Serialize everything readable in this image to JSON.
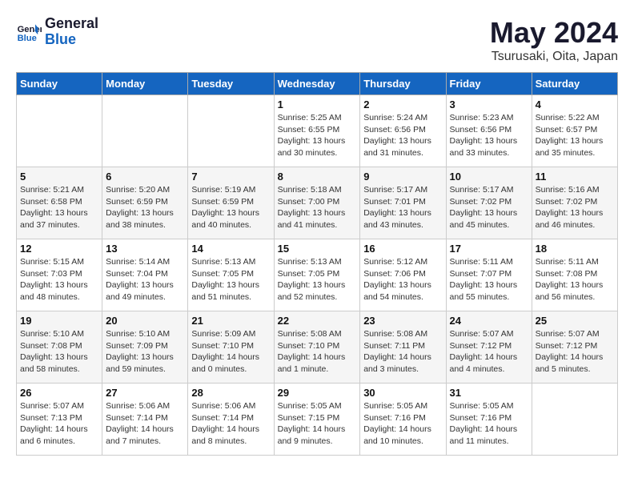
{
  "logo": {
    "line1": "General",
    "line2": "Blue"
  },
  "title": "May 2024",
  "subtitle": "Tsurusaki, Oita, Japan",
  "days_of_week": [
    "Sunday",
    "Monday",
    "Tuesday",
    "Wednesday",
    "Thursday",
    "Friday",
    "Saturday"
  ],
  "weeks": [
    [
      {
        "day": "",
        "info": ""
      },
      {
        "day": "",
        "info": ""
      },
      {
        "day": "",
        "info": ""
      },
      {
        "day": "1",
        "info": "Sunrise: 5:25 AM\nSunset: 6:55 PM\nDaylight: 13 hours\nand 30 minutes."
      },
      {
        "day": "2",
        "info": "Sunrise: 5:24 AM\nSunset: 6:56 PM\nDaylight: 13 hours\nand 31 minutes."
      },
      {
        "day": "3",
        "info": "Sunrise: 5:23 AM\nSunset: 6:56 PM\nDaylight: 13 hours\nand 33 minutes."
      },
      {
        "day": "4",
        "info": "Sunrise: 5:22 AM\nSunset: 6:57 PM\nDaylight: 13 hours\nand 35 minutes."
      }
    ],
    [
      {
        "day": "5",
        "info": "Sunrise: 5:21 AM\nSunset: 6:58 PM\nDaylight: 13 hours\nand 37 minutes."
      },
      {
        "day": "6",
        "info": "Sunrise: 5:20 AM\nSunset: 6:59 PM\nDaylight: 13 hours\nand 38 minutes."
      },
      {
        "day": "7",
        "info": "Sunrise: 5:19 AM\nSunset: 6:59 PM\nDaylight: 13 hours\nand 40 minutes."
      },
      {
        "day": "8",
        "info": "Sunrise: 5:18 AM\nSunset: 7:00 PM\nDaylight: 13 hours\nand 41 minutes."
      },
      {
        "day": "9",
        "info": "Sunrise: 5:17 AM\nSunset: 7:01 PM\nDaylight: 13 hours\nand 43 minutes."
      },
      {
        "day": "10",
        "info": "Sunrise: 5:17 AM\nSunset: 7:02 PM\nDaylight: 13 hours\nand 45 minutes."
      },
      {
        "day": "11",
        "info": "Sunrise: 5:16 AM\nSunset: 7:02 PM\nDaylight: 13 hours\nand 46 minutes."
      }
    ],
    [
      {
        "day": "12",
        "info": "Sunrise: 5:15 AM\nSunset: 7:03 PM\nDaylight: 13 hours\nand 48 minutes."
      },
      {
        "day": "13",
        "info": "Sunrise: 5:14 AM\nSunset: 7:04 PM\nDaylight: 13 hours\nand 49 minutes."
      },
      {
        "day": "14",
        "info": "Sunrise: 5:13 AM\nSunset: 7:05 PM\nDaylight: 13 hours\nand 51 minutes."
      },
      {
        "day": "15",
        "info": "Sunrise: 5:13 AM\nSunset: 7:05 PM\nDaylight: 13 hours\nand 52 minutes."
      },
      {
        "day": "16",
        "info": "Sunrise: 5:12 AM\nSunset: 7:06 PM\nDaylight: 13 hours\nand 54 minutes."
      },
      {
        "day": "17",
        "info": "Sunrise: 5:11 AM\nSunset: 7:07 PM\nDaylight: 13 hours\nand 55 minutes."
      },
      {
        "day": "18",
        "info": "Sunrise: 5:11 AM\nSunset: 7:08 PM\nDaylight: 13 hours\nand 56 minutes."
      }
    ],
    [
      {
        "day": "19",
        "info": "Sunrise: 5:10 AM\nSunset: 7:08 PM\nDaylight: 13 hours\nand 58 minutes."
      },
      {
        "day": "20",
        "info": "Sunrise: 5:10 AM\nSunset: 7:09 PM\nDaylight: 13 hours\nand 59 minutes."
      },
      {
        "day": "21",
        "info": "Sunrise: 5:09 AM\nSunset: 7:10 PM\nDaylight: 14 hours\nand 0 minutes."
      },
      {
        "day": "22",
        "info": "Sunrise: 5:08 AM\nSunset: 7:10 PM\nDaylight: 14 hours\nand 1 minute."
      },
      {
        "day": "23",
        "info": "Sunrise: 5:08 AM\nSunset: 7:11 PM\nDaylight: 14 hours\nand 3 minutes."
      },
      {
        "day": "24",
        "info": "Sunrise: 5:07 AM\nSunset: 7:12 PM\nDaylight: 14 hours\nand 4 minutes."
      },
      {
        "day": "25",
        "info": "Sunrise: 5:07 AM\nSunset: 7:12 PM\nDaylight: 14 hours\nand 5 minutes."
      }
    ],
    [
      {
        "day": "26",
        "info": "Sunrise: 5:07 AM\nSunset: 7:13 PM\nDaylight: 14 hours\nand 6 minutes."
      },
      {
        "day": "27",
        "info": "Sunrise: 5:06 AM\nSunset: 7:14 PM\nDaylight: 14 hours\nand 7 minutes."
      },
      {
        "day": "28",
        "info": "Sunrise: 5:06 AM\nSunset: 7:14 PM\nDaylight: 14 hours\nand 8 minutes."
      },
      {
        "day": "29",
        "info": "Sunrise: 5:05 AM\nSunset: 7:15 PM\nDaylight: 14 hours\nand 9 minutes."
      },
      {
        "day": "30",
        "info": "Sunrise: 5:05 AM\nSunset: 7:16 PM\nDaylight: 14 hours\nand 10 minutes."
      },
      {
        "day": "31",
        "info": "Sunrise: 5:05 AM\nSunset: 7:16 PM\nDaylight: 14 hours\nand 11 minutes."
      },
      {
        "day": "",
        "info": ""
      }
    ]
  ]
}
